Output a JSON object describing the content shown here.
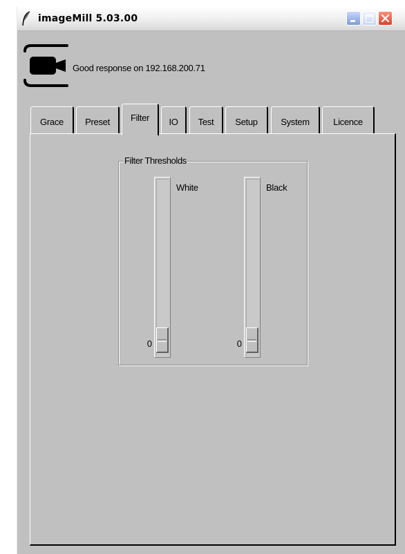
{
  "window": {
    "title": "imageMill 5.03.00"
  },
  "status": {
    "message": "Good response on 192.168.200.71"
  },
  "tabs": [
    {
      "label": "Grace"
    },
    {
      "label": "Preset"
    },
    {
      "label": "Filter"
    },
    {
      "label": "IO"
    },
    {
      "label": "Test"
    },
    {
      "label": "Setup"
    },
    {
      "label": "System"
    },
    {
      "label": "Licence"
    }
  ],
  "active_tab": "Filter",
  "filter": {
    "group_title": "Filter Thresholds",
    "sliders": [
      {
        "label": "White",
        "value": "0",
        "fraction": 0
      },
      {
        "label": "Black",
        "value": "0",
        "fraction": 0
      }
    ]
  },
  "icons": {
    "title": "feather-icon",
    "status": "camera-icon",
    "minimize": "minimize-icon",
    "maximize": "maximize-icon",
    "close": "close-icon"
  },
  "colors": {
    "window_bg": "#c0c0c0",
    "close_button": "#d2442b",
    "minimize_button": "#7f9ad8"
  }
}
